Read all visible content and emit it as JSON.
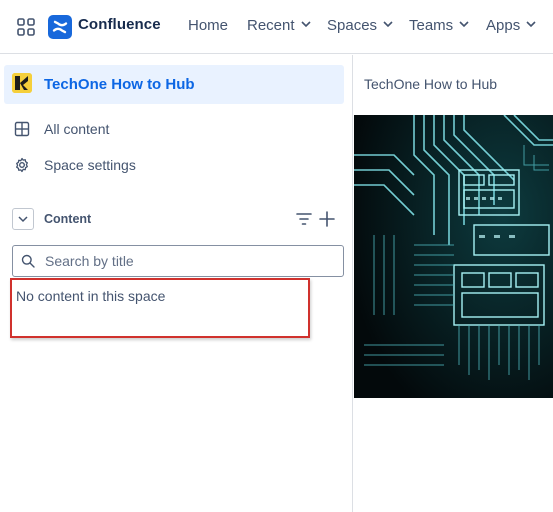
{
  "topbar": {
    "app_name": "Confluence",
    "nav": {
      "home": "Home",
      "recent": "Recent",
      "spaces": "Spaces",
      "teams": "Teams",
      "apps": "Apps"
    }
  },
  "sidebar": {
    "space_name": "TechOne How to Hub",
    "items": [
      {
        "label": "All content",
        "icon": "grid-icon"
      },
      {
        "label": "Space settings",
        "icon": "gear-icon"
      }
    ],
    "content_section": {
      "heading": "Content",
      "search_placeholder": "Search by title",
      "empty_message": "No content in this space"
    }
  },
  "main": {
    "page_title": "TechOne How to Hub",
    "banner": "circuit-board-image"
  },
  "colors": {
    "brand": "#1868db",
    "selected_bg": "#e9f2ff",
    "selected_text": "#0c66e4",
    "highlight": "#d0312d"
  }
}
